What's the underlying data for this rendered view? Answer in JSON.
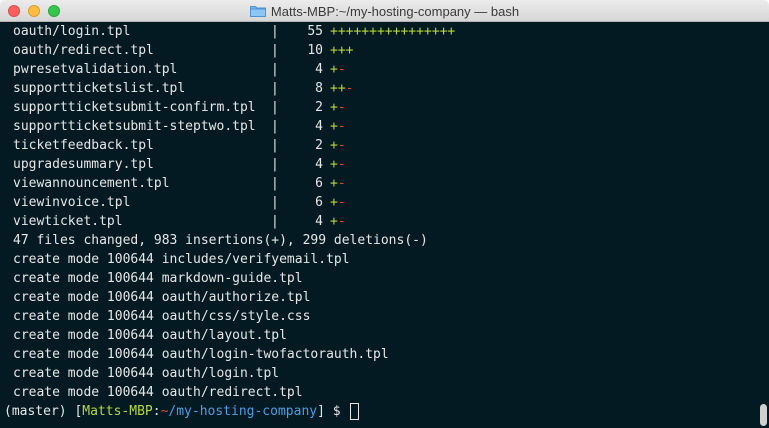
{
  "window": {
    "title": "Matts-MBP:~/my-hosting-company — bash"
  },
  "diffstat": [
    {
      "file": "oauth/login.tpl",
      "count": "55",
      "plus": "++++++++++++++++",
      "minus": ""
    },
    {
      "file": "oauth/redirect.tpl",
      "count": "10",
      "plus": "+++",
      "minus": ""
    },
    {
      "file": "pwresetvalidation.tpl",
      "count": "4",
      "plus": "+",
      "minus": "-"
    },
    {
      "file": "supportticketslist.tpl",
      "count": "8",
      "plus": "++",
      "minus": "-"
    },
    {
      "file": "supportticketsubmit-confirm.tpl",
      "count": "2",
      "plus": "+",
      "minus": "-"
    },
    {
      "file": "supportticketsubmit-steptwo.tpl",
      "count": "4",
      "plus": "+",
      "minus": "-"
    },
    {
      "file": "ticketfeedback.tpl",
      "count": "2",
      "plus": "+",
      "minus": "-"
    },
    {
      "file": "upgradesummary.tpl",
      "count": "4",
      "plus": "+",
      "minus": "-"
    },
    {
      "file": "viewannouncement.tpl",
      "count": "6",
      "plus": "+",
      "minus": "-"
    },
    {
      "file": "viewinvoice.tpl",
      "count": "6",
      "plus": "+",
      "minus": "-"
    },
    {
      "file": "viewticket.tpl",
      "count": "4",
      "plus": "+",
      "minus": "-"
    }
  ],
  "separator": "|",
  "summary": "47 files changed, 983 insertions(+), 299 deletions(-)",
  "create_lines": [
    "create mode 100644 includes/verifyemail.tpl",
    "create mode 100644 markdown-guide.tpl",
    "create mode 100644 oauth/authorize.tpl",
    "create mode 100644 oauth/css/style.css",
    "create mode 100644 oauth/layout.tpl",
    "create mode 100644 oauth/login-twofactorauth.tpl",
    "create mode 100644 oauth/login.tpl",
    "create mode 100644 oauth/redirect.tpl"
  ],
  "prompt": {
    "branch": "(master)",
    "open_bracket": "[",
    "host": "Matts-MBP",
    "colon": ":",
    "tilde": "~",
    "path": "/my-hosting-company",
    "close_bracket": "]",
    "symbol": "$"
  },
  "colors": {
    "background": "#041a22",
    "text": "#e6e6e6",
    "plus": "#b9d830",
    "minus": "#e04a3a",
    "path": "#4a9fe8"
  },
  "icons": {
    "title_icon": "folder-icon"
  }
}
